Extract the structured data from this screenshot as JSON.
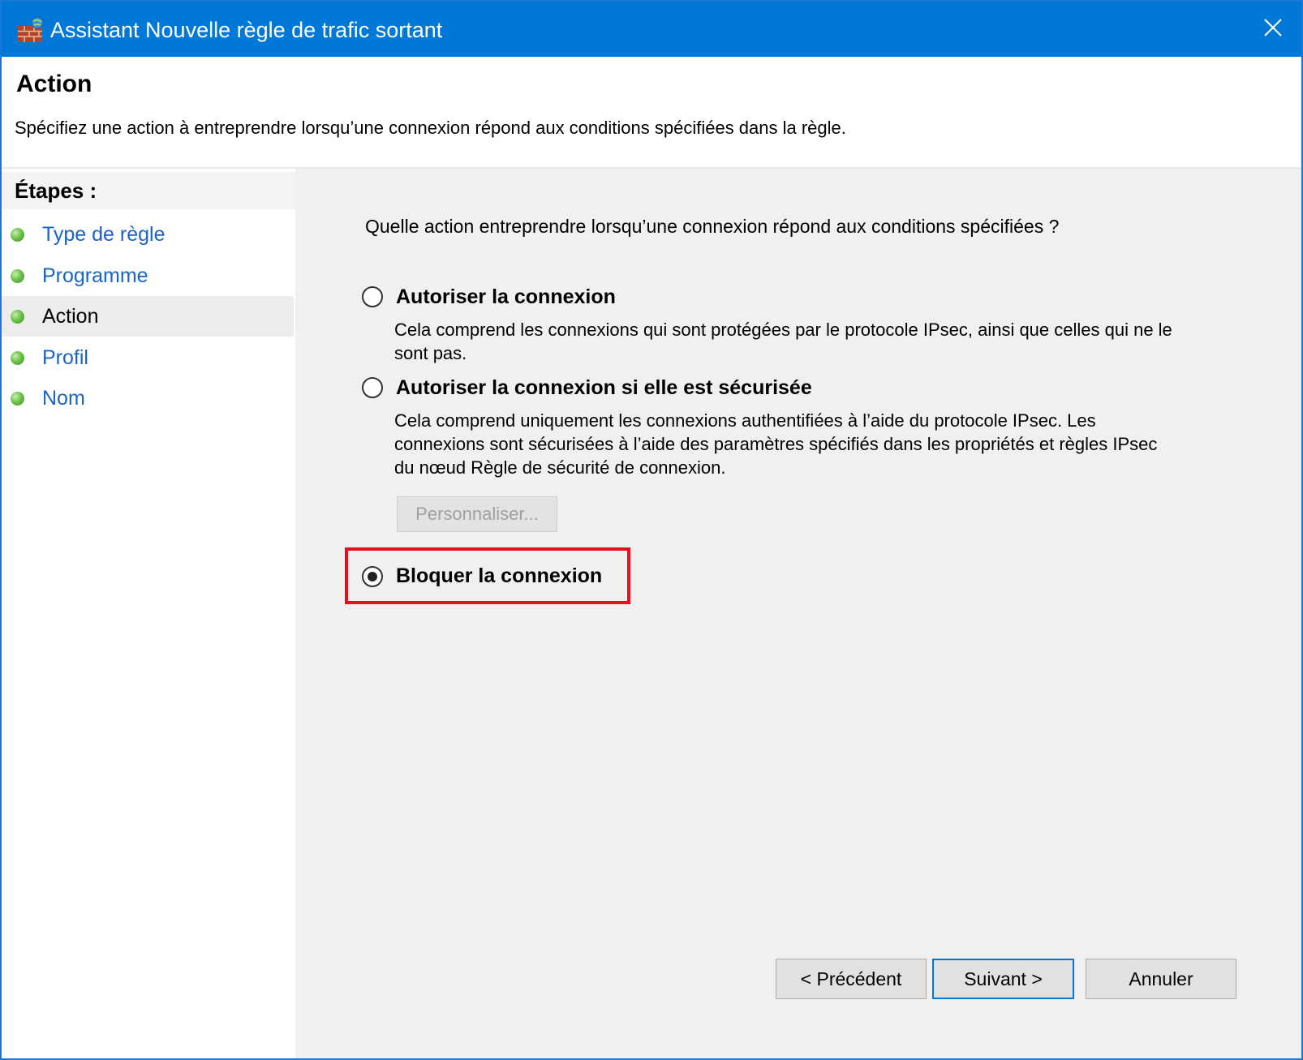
{
  "window": {
    "title": "Assistant Nouvelle règle de trafic sortant"
  },
  "header": {
    "title": "Action",
    "subtitle": "Spécifiez une action à entreprendre lorsqu’une connexion répond aux conditions spécifiées dans la règle."
  },
  "sidebar": {
    "title": "Étapes :",
    "items": [
      {
        "label": "Type de règle"
      },
      {
        "label": "Programme"
      },
      {
        "label": "Action"
      },
      {
        "label": "Profil"
      },
      {
        "label": "Nom"
      }
    ]
  },
  "main": {
    "question": "Quelle action entreprendre lorsqu’une connexion répond aux conditions spécifiées ?",
    "options": [
      {
        "label": "Autoriser la connexion",
        "description": "Cela comprend les connexions qui sont protégées par le protocole IPsec, ainsi que celles qui ne le sont pas.",
        "selected": false
      },
      {
        "label": "Autoriser la connexion si elle est sécurisée",
        "description": "Cela comprend uniquement les connexions authentifiées à l’aide du protocole IPsec. Les connexions sont sécurisées à l’aide des paramètres spécifiés dans les propriétés et règles IPsec du nœud Règle de sécurité de connexion.",
        "selected": false
      },
      {
        "label": "Bloquer la connexion",
        "selected": true
      }
    ],
    "customize_label": "Personnaliser..."
  },
  "footer": {
    "back_label": "< Précédent",
    "next_label": "Suivant >",
    "cancel_label": "Annuler"
  },
  "colors": {
    "titlebar": "#0078d7",
    "link": "#1a64c8",
    "highlight": "#e3111e"
  },
  "icons": {
    "app": "firewall-icon",
    "close": "close-icon",
    "step": "green-dot-icon"
  }
}
